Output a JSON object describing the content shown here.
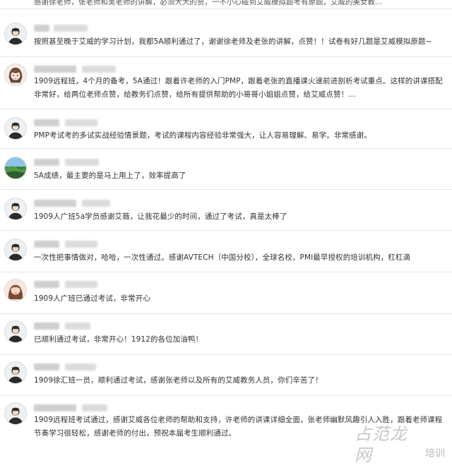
{
  "top_snippet": "感谢徐老师，张老师和吴老师的讲解，必须大大的赞，一不小心碰到艾威模拟题考有原题，艾威的美女教...",
  "comments": [
    {
      "avatar": "default-avatar-icon",
      "text": "按照甚至晚于艾威的学习计划，我都5A顺利通过了，谢谢徐老师及老张的讲解，点赞！！试卷有好几题是艾威模拟原题~"
    },
    {
      "avatar": "anime-girl-avatar",
      "text": "1909远程班，4个月的备考，5A通过！跟着许老师的入门PMP，跟着老张的直播课火速前进剖析考试重点。这样的讲课搭配非常好，给两位老师点赞，给教务们点赞，给所有提供帮助的小哥哥小姐姐点赞，给艾威点赞！..."
    },
    {
      "avatar": "default-avatar-icon",
      "text": "PMP考试考的多试实战经验情景题，考试的课程内容经验非常强大，让人容易理解、易学。非常感谢。"
    },
    {
      "avatar": "landscape-avatar",
      "text": "5A成绩，最主要的是马上用上了，效率提高了"
    },
    {
      "avatar": "default-avatar-icon",
      "text": "1909人广班5a学员感谢艾薇，让我花最少的时间，通过了考试，真是太棒了"
    },
    {
      "avatar": "default-avatar-icon",
      "text": "一次性把事情做对，哈哈，一次性通过。感谢AVTECH（中国分校），全球名校，PMI最早授权的培训机构，杠杠滴"
    },
    {
      "avatar": "woman-photo-avatar",
      "text": "1909人广班已通过考试，非常开心"
    },
    {
      "avatar": "default-avatar-icon",
      "text": "已顺利通过考试，非常开心！1912的各位加油鸭！"
    },
    {
      "avatar": "default-avatar-icon",
      "text": "1909徐汇班一员，顺利通过考试，感谢张老师以及所有的艾威教务人员，你们辛苦了！"
    },
    {
      "avatar": "default-avatar-icon",
      "text": "1909远程班考试通过，感谢艾威各位老师的帮助和支持，许老师的讲课详细全面，张老师幽默风趣引人入胜，跟着老师课程节奏学习很轻松，感谢老师的付出，预祝本届考生顺利通过。"
    }
  ],
  "watermark": {
    "logo": "占范龙网",
    "site": "培训"
  }
}
